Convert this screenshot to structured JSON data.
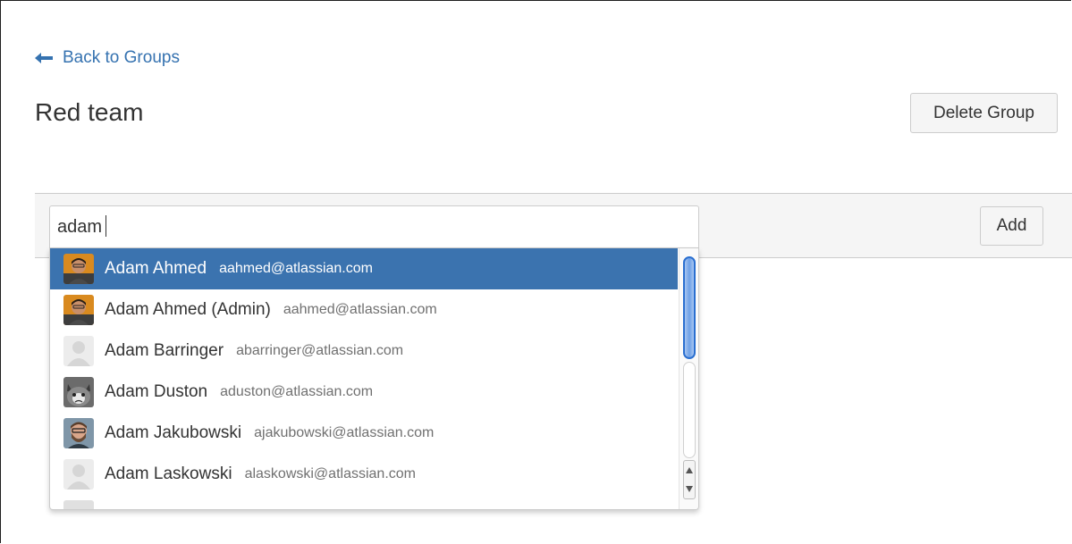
{
  "nav": {
    "back_label": "Back to Groups"
  },
  "group": {
    "title": "Red team",
    "delete_label": "Delete Group"
  },
  "add_member": {
    "query": "adam",
    "add_label": "Add"
  },
  "suggestions": [
    {
      "name": "Adam Ahmed",
      "email": "aahmed@atlassian.com",
      "avatar": "photo-man-orange"
    },
    {
      "name": "Adam Ahmed (Admin)",
      "email": "aahmed@atlassian.com",
      "avatar": "photo-man-orange"
    },
    {
      "name": "Adam Barringer",
      "email": "abarringer@atlassian.com",
      "avatar": "default-avatar"
    },
    {
      "name": "Adam Duston",
      "email": "aduston@atlassian.com",
      "avatar": "photo-cat"
    },
    {
      "name": "Adam Jakubowski",
      "email": "ajakubowski@atlassian.com",
      "avatar": "photo-man-beard"
    },
    {
      "name": "Adam Laskowski",
      "email": "alaskowski@atlassian.com",
      "avatar": "default-avatar"
    }
  ],
  "colors": {
    "link": "#3572b0",
    "selected_row": "#3b73af",
    "bar_background": "#f5f5f5"
  }
}
